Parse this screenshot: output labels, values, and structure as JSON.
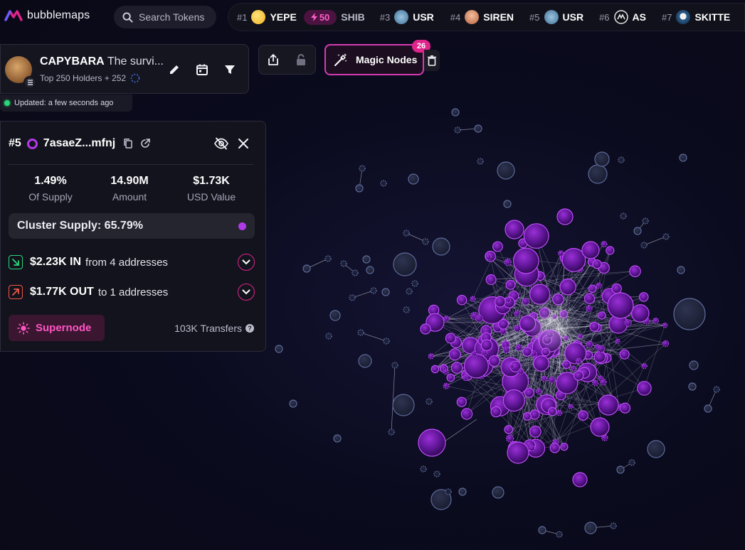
{
  "header": {
    "brand": "bubblemaps",
    "search_placeholder": "Search Tokens",
    "ticker": [
      {
        "rank": "#1",
        "name": "YEPE",
        "boost": "50",
        "logo_color": "#f5c542"
      },
      {
        "rank": "",
        "name": "SHIB",
        "logo_color": ""
      },
      {
        "rank": "#3",
        "name": "USR",
        "logo_color": "#5a8ab0"
      },
      {
        "rank": "#4",
        "name": "SIREN",
        "logo_color": "#d98a6a"
      },
      {
        "rank": "#5",
        "name": "USR",
        "logo_color": "#5a8ab0"
      },
      {
        "rank": "#6",
        "name": "AS",
        "logo_color": "#e8e8e8"
      },
      {
        "rank": "#7",
        "name": "SKITTE",
        "logo_color": "#3a6ea5"
      }
    ]
  },
  "token": {
    "symbol": "CAPYBARA",
    "name": "The survi...",
    "subtitle": "Top 250 Holders + 252",
    "updated": "Updated: a few seconds ago"
  },
  "toolbar": {
    "magic_nodes_label": "Magic Nodes",
    "magic_nodes_count": "26"
  },
  "details": {
    "rank": "#5",
    "address": "7asaeZ...mfnj",
    "stats": [
      {
        "value": "1.49%",
        "label": "Of Supply"
      },
      {
        "value": "14.90M",
        "label": "Amount"
      },
      {
        "value": "$1.73K",
        "label": "USD Value"
      }
    ],
    "cluster_supply": "Cluster Supply: 65.79%",
    "inflow": {
      "amount": "$2.23K IN",
      "detail": "from 4 addresses"
    },
    "outflow": {
      "amount": "$1.77K OUT",
      "detail": "to 1 addresses"
    },
    "supernode_label": "Supernode",
    "transfers": "103K Transfers"
  },
  "colors": {
    "accent_pink": "#e0248c",
    "accent_purple": "#b13ae8",
    "in_green": "#2bd67b",
    "out_red": "#f0584a",
    "background": "#0b0b1f"
  }
}
